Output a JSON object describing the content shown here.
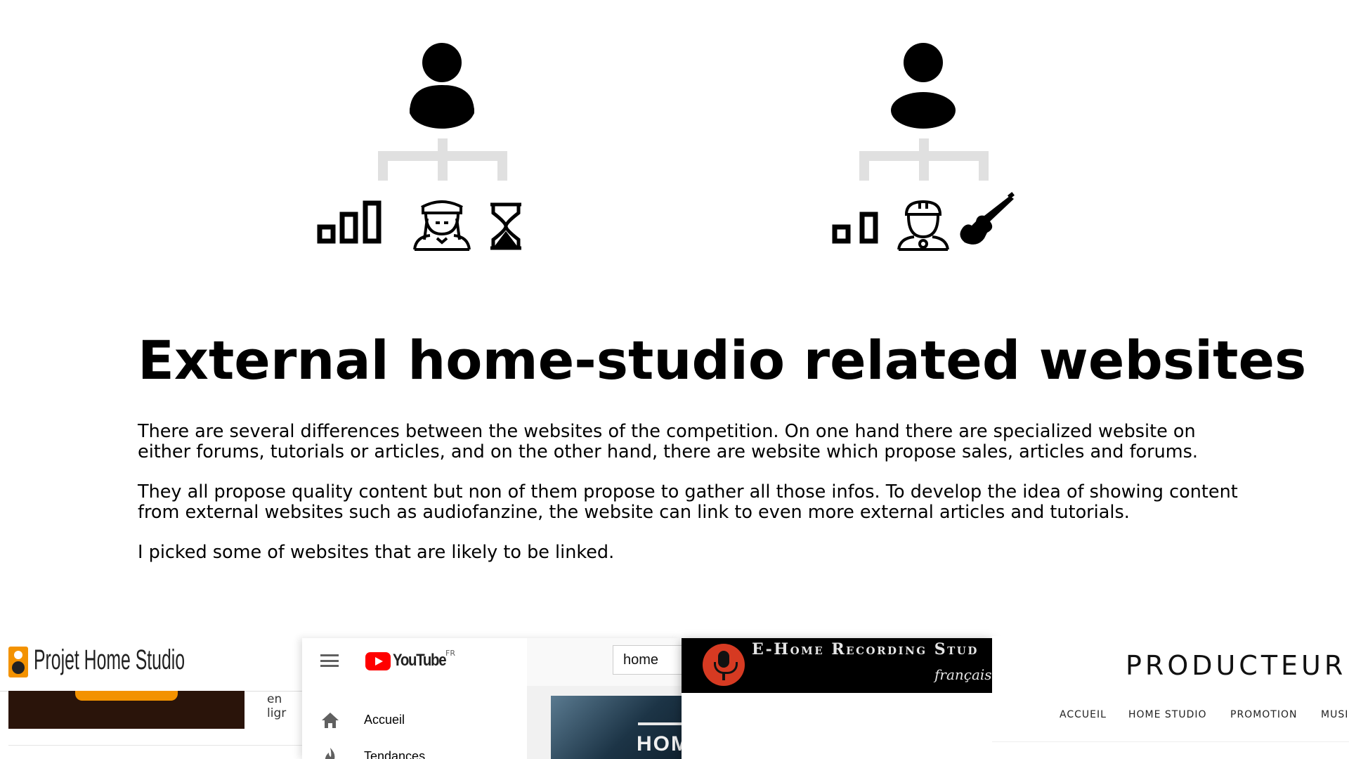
{
  "personas": [
    {
      "icons": [
        "person-icon",
        "signal-bars-icon",
        "musician-icon",
        "hourglass-icon"
      ]
    },
    {
      "icons": [
        "person-icon",
        "signal-bars-icon",
        "worker-icon",
        "electric-guitar-icon"
      ]
    }
  ],
  "heading": "External home-studio related websites",
  "paragraphs": [
    "There are several differences between the websites of the competition. On one hand there are specialized website on either forums, tutorials or articles, and on the other hand, there are website which propose sales, articles and forums.",
    "They all propose quality content but non of them propose to gather all those infos. To develop the idea of showing content from external websites such as audiofanzine, the website can link to even more external articles and tutorials.",
    "I picked some of websites that are likely to be linked."
  ],
  "screenshots": {
    "projet_home_studio": {
      "logo": "Projet Home Studio",
      "snippet": "en ligr"
    },
    "youtube": {
      "logo": "YouTube",
      "region": "FR",
      "search_value": "home",
      "sidebar_items": [
        {
          "label": "Accueil",
          "icon": "home-icon"
        },
        {
          "label": "Tendances",
          "icon": "flame-icon"
        }
      ],
      "thumb_text": "HOM"
    },
    "ehome": {
      "title": "E-Home Recording Stud",
      "language": "français"
    },
    "producteur": {
      "logo": "PRODUCTEUR",
      "nav": [
        "ACCUEIL",
        "HOME STUDIO",
        "PROMOTION",
        "MUSI"
      ]
    }
  },
  "colors": {
    "tree_connector": "#e0e0e0",
    "youtube_red": "#ff0000",
    "phs_orange": "#f39200",
    "ehome_red": "#d63a22"
  }
}
